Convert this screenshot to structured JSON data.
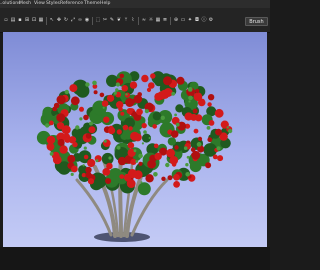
{
  "menu": {
    "items": [
      "...olutions",
      "Mesh",
      "View",
      "Styles",
      "Reference",
      "Theme",
      "Help"
    ]
  },
  "toolbar": {
    "tools": [
      "file-icon",
      "open-icon",
      "save-icon",
      "import-icon",
      "export-icon",
      "render-icon",
      "pointer-icon",
      "move-icon",
      "rotate-icon",
      "scale-icon",
      "link-icon",
      "eye-icon",
      "select-icon",
      "cut-icon",
      "brush-icon",
      "leaf-icon",
      "branch-icon",
      "prune-icon",
      "wind-icon",
      "sun-icon",
      "grid-icon",
      "layers-icon",
      "zoom-icon",
      "frame-icon",
      "light-icon",
      "camera-icon",
      "info-icon",
      "settings-icon"
    ],
    "brush_label": "Brush"
  },
  "viewport": {
    "sky_top": "#7f8cd6",
    "sky_bottom": "#c4cbf5",
    "foliage_color": "#1f5a1f",
    "flower_color": "#d31a1a",
    "trunk_color": "#8f8a80"
  }
}
